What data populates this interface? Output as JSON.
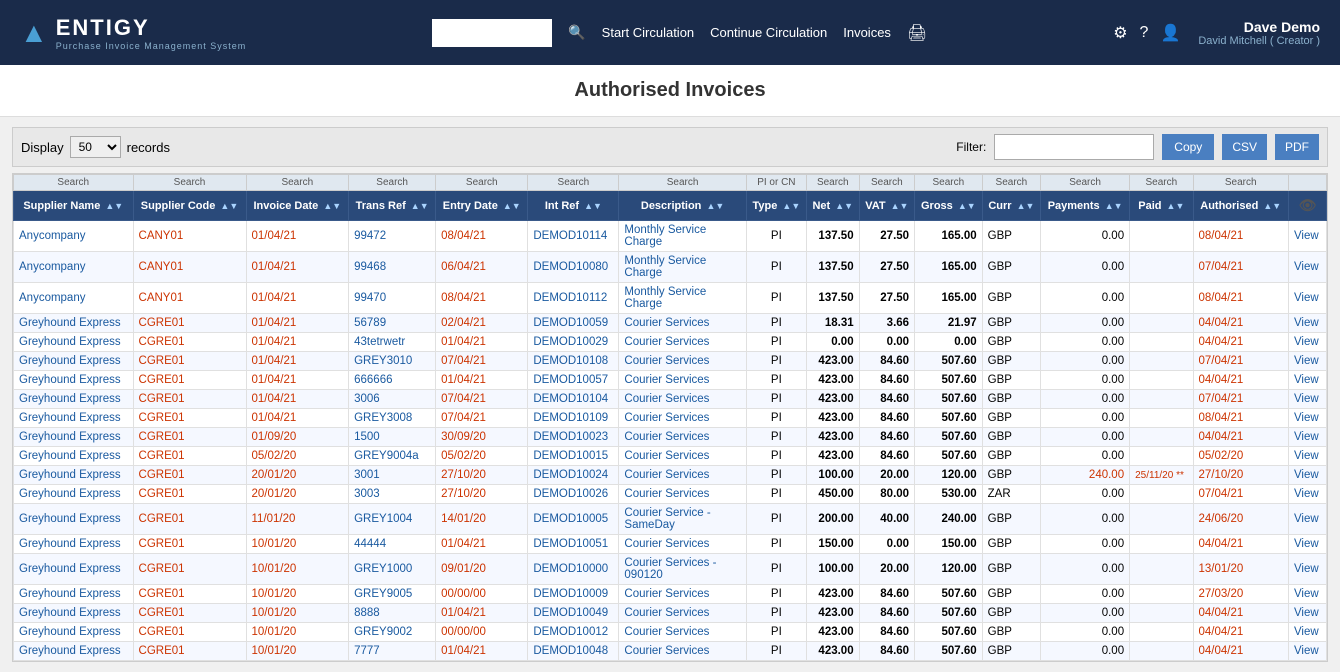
{
  "header": {
    "logo_title": "ENTIGY",
    "logo_subtitle": "Purchase Invoice Management System",
    "search_placeholder": "",
    "nav_links": [
      "Start Circulation",
      "Continue Circulation",
      "Invoices"
    ],
    "user_name": "Dave Demo",
    "user_sub": "David Mitchell ( Creator )"
  },
  "page": {
    "title": "Authorised Invoices",
    "display_label": "Display",
    "records_label": "records",
    "display_value": "50",
    "filter_label": "Filter:",
    "btn_copy": "Copy",
    "btn_csv": "CSV",
    "btn_pdf": "PDF"
  },
  "table": {
    "columns": [
      "Supplier Name",
      "Supplier Code",
      "Invoice Date",
      "Trans Ref",
      "Entry Date",
      "Int Ref",
      "Description",
      "Type",
      "Net",
      "VAT",
      "Gross",
      "Curr",
      "Payments",
      "Paid",
      "Authorised"
    ],
    "rows": [
      [
        "Anycompany",
        "CANY01",
        "01/04/21",
        "99472",
        "08/04/21",
        "DEMOD10114",
        "Monthly Service Charge",
        "PI",
        "137.50",
        "27.50",
        "165.00",
        "GBP",
        "0.00",
        "",
        "08/04/21"
      ],
      [
        "Anycompany",
        "CANY01",
        "01/04/21",
        "99468",
        "06/04/21",
        "DEMOD10080",
        "Monthly Service Charge",
        "PI",
        "137.50",
        "27.50",
        "165.00",
        "GBP",
        "0.00",
        "",
        "07/04/21"
      ],
      [
        "Anycompany",
        "CANY01",
        "01/04/21",
        "99470",
        "08/04/21",
        "DEMOD10112",
        "Monthly Service Charge",
        "PI",
        "137.50",
        "27.50",
        "165.00",
        "GBP",
        "0.00",
        "",
        "08/04/21"
      ],
      [
        "Greyhound Express",
        "CGRE01",
        "01/04/21",
        "56789",
        "02/04/21",
        "DEMOD10059",
        "Courier Services",
        "PI",
        "18.31",
        "3.66",
        "21.97",
        "GBP",
        "0.00",
        "",
        "04/04/21"
      ],
      [
        "Greyhound Express",
        "CGRE01",
        "01/04/21",
        "43tetrwetr",
        "01/04/21",
        "DEMOD10029",
        "Courier Services",
        "PI",
        "0.00",
        "0.00",
        "0.00",
        "GBP",
        "0.00",
        "",
        "04/04/21"
      ],
      [
        "Greyhound Express",
        "CGRE01",
        "01/04/21",
        "GREY3010",
        "07/04/21",
        "DEMOD10108",
        "Courier Services",
        "PI",
        "423.00",
        "84.60",
        "507.60",
        "GBP",
        "0.00",
        "",
        "07/04/21"
      ],
      [
        "Greyhound Express",
        "CGRE01",
        "01/04/21",
        "666666",
        "01/04/21",
        "DEMOD10057",
        "Courier Services",
        "PI",
        "423.00",
        "84.60",
        "507.60",
        "GBP",
        "0.00",
        "",
        "04/04/21"
      ],
      [
        "Greyhound Express",
        "CGRE01",
        "01/04/21",
        "3006",
        "07/04/21",
        "DEMOD10104",
        "Courier Services",
        "PI",
        "423.00",
        "84.60",
        "507.60",
        "GBP",
        "0.00",
        "",
        "07/04/21"
      ],
      [
        "Greyhound Express",
        "CGRE01",
        "01/04/21",
        "GREY3008",
        "07/04/21",
        "DEMOD10109",
        "Courier Services",
        "PI",
        "423.00",
        "84.60",
        "507.60",
        "GBP",
        "0.00",
        "",
        "08/04/21"
      ],
      [
        "Greyhound Express",
        "CGRE01",
        "01/09/20",
        "1500",
        "30/09/20",
        "DEMOD10023",
        "Courier Services",
        "PI",
        "423.00",
        "84.60",
        "507.60",
        "GBP",
        "0.00",
        "",
        "04/04/21"
      ],
      [
        "Greyhound Express",
        "CGRE01",
        "05/02/20",
        "GREY9004a",
        "05/02/20",
        "DEMOD10015",
        "Courier Services",
        "PI",
        "423.00",
        "84.60",
        "507.60",
        "GBP",
        "0.00",
        "",
        "05/02/20"
      ],
      [
        "Greyhound Express",
        "CGRE01",
        "20/01/20",
        "3001",
        "27/10/20",
        "DEMOD10024",
        "Courier Services",
        "PI",
        "100.00",
        "20.00",
        "120.00",
        "GBP",
        "240.00",
        "25/11/20 **",
        "27/10/20"
      ],
      [
        "Greyhound Express",
        "CGRE01",
        "20/01/20",
        "3003",
        "27/10/20",
        "DEMOD10026",
        "Courier Services",
        "PI",
        "450.00",
        "80.00",
        "530.00",
        "ZAR",
        "0.00",
        "",
        "07/04/21"
      ],
      [
        "Greyhound Express",
        "CGRE01",
        "11/01/20",
        "GREY1004",
        "14/01/20",
        "DEMOD10005",
        "Courier Service - SameDay",
        "PI",
        "200.00",
        "40.00",
        "240.00",
        "GBP",
        "0.00",
        "",
        "24/06/20"
      ],
      [
        "Greyhound Express",
        "CGRE01",
        "10/01/20",
        "44444",
        "01/04/21",
        "DEMOD10051",
        "Courier Services",
        "PI",
        "150.00",
        "0.00",
        "150.00",
        "GBP",
        "0.00",
        "",
        "04/04/21"
      ],
      [
        "Greyhound Express",
        "CGRE01",
        "10/01/20",
        "GREY1000",
        "09/01/20",
        "DEMOD10000",
        "Courier Services - 090120",
        "PI",
        "100.00",
        "20.00",
        "120.00",
        "GBP",
        "0.00",
        "",
        "13/01/20"
      ],
      [
        "Greyhound Express",
        "CGRE01",
        "10/01/20",
        "GREY9005",
        "00/00/00",
        "DEMOD10009",
        "Courier Services",
        "PI",
        "423.00",
        "84.60",
        "507.60",
        "GBP",
        "0.00",
        "",
        "27/03/20"
      ],
      [
        "Greyhound Express",
        "CGRE01",
        "10/01/20",
        "8888",
        "01/04/21",
        "DEMOD10049",
        "Courier Services",
        "PI",
        "423.00",
        "84.60",
        "507.60",
        "GBP",
        "0.00",
        "",
        "04/04/21"
      ],
      [
        "Greyhound Express",
        "CGRE01",
        "10/01/20",
        "GREY9002",
        "00/00/00",
        "DEMOD10012",
        "Courier Services",
        "PI",
        "423.00",
        "84.60",
        "507.60",
        "GBP",
        "0.00",
        "",
        "04/04/21"
      ],
      [
        "Greyhound Express",
        "CGRE01",
        "10/01/20",
        "7777",
        "01/04/21",
        "DEMOD10048",
        "Courier Services",
        "PI",
        "423.00",
        "84.60",
        "507.60",
        "GBP",
        "0.00",
        "",
        "04/04/21"
      ]
    ]
  }
}
